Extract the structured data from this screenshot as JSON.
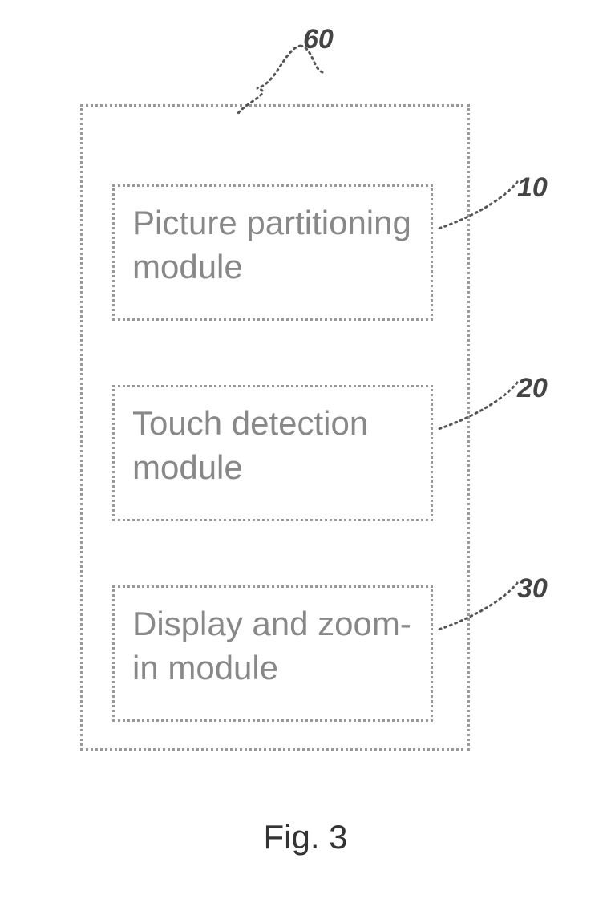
{
  "modules": {
    "m1": "Picture partitioning module",
    "m2": "Touch detection module",
    "m3": "Display and zoom-in module"
  },
  "labels": {
    "ref60": "60",
    "ref10": "10",
    "ref20": "20",
    "ref30": "30"
  },
  "caption": "Fig. 3"
}
